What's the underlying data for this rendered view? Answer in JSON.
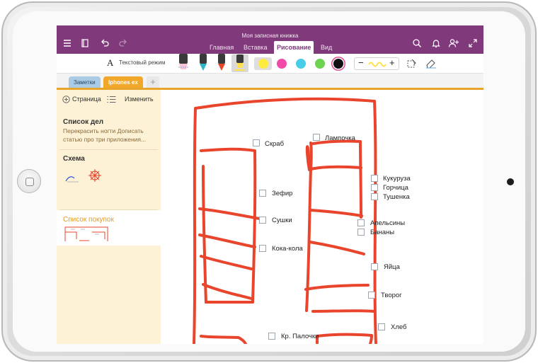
{
  "app": {
    "title": "Моя записная книжка"
  },
  "ribbon_tabs": [
    {
      "label": "Главная",
      "active": false
    },
    {
      "label": "Вставка",
      "active": false
    },
    {
      "label": "Рисование",
      "active": true
    },
    {
      "label": "Вид",
      "active": false
    }
  ],
  "toolbar": {
    "text_mode_glyph": "A",
    "text_mode_label": "Текстовый режим",
    "minus": "−",
    "plus": "+"
  },
  "colors": {
    "accent": "#80397b",
    "section_line": "#e8a52b",
    "ink": "#e8452c",
    "palette": [
      "#ffeb3b",
      "#f34aa9",
      "#48cde8",
      "#6bd34f",
      "#111111"
    ]
  },
  "sections": [
    {
      "label": "Заметки",
      "color": "#a9cbe3",
      "text_color": "#2a4a66"
    },
    {
      "label": "Iphones ex",
      "color": "#f0a72a",
      "text_color": "#ffffff"
    }
  ],
  "section_add": "+",
  "pagelist": {
    "add_page_label": "Страница",
    "edit_label": "Изменить",
    "pages": [
      {
        "title": "Список дел",
        "preview": "Перекрасить ногти  Дописать статью про три приложения...",
        "selected": false
      },
      {
        "title": "Схема",
        "preview": "",
        "selected": false
      },
      {
        "title": "Список покупок",
        "preview": "",
        "selected": true
      }
    ]
  },
  "note": {
    "items": [
      "Скраб",
      "Лампочка",
      "Зефир",
      "Сушки",
      "Кока-кола",
      "Кукуруза",
      "Горчица",
      "Тушенка",
      "Апельсины",
      "Бананы",
      "Яйца",
      "Творог",
      "Кр. Палочки",
      "Хлеб"
    ]
  },
  "icons": [
    "menu-icon",
    "notebooks-icon",
    "undo-icon",
    "redo-icon",
    "search-icon",
    "bell-icon",
    "add-person-icon",
    "expand-icon",
    "lasso-icon",
    "eraser-icon"
  ]
}
